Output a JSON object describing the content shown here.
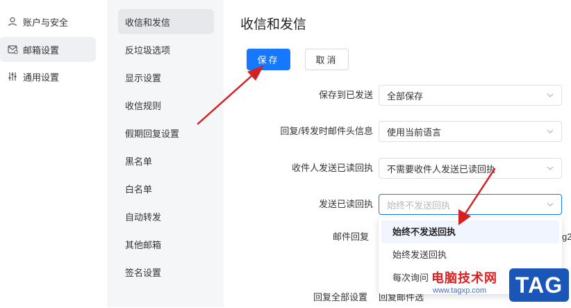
{
  "sidebar": {
    "items": [
      {
        "label": "账户与安全",
        "icon": "user-icon"
      },
      {
        "label": "邮箱设置",
        "icon": "mailbox-settings-icon",
        "active": true
      },
      {
        "label": "通用设置",
        "icon": "sliders-icon"
      }
    ]
  },
  "subnav": {
    "items": [
      {
        "label": "收信和发信",
        "active": true
      },
      {
        "label": "反垃圾选项"
      },
      {
        "label": "显示设置"
      },
      {
        "label": "收信规则"
      },
      {
        "label": "假期回复设置"
      },
      {
        "label": "黑名单"
      },
      {
        "label": "白名单"
      },
      {
        "label": "自动转发"
      },
      {
        "label": "其他邮箱"
      },
      {
        "label": "签名设置"
      }
    ]
  },
  "main": {
    "title": "收信和发信",
    "save_label": "保存",
    "cancel_label": "取消",
    "rows": [
      {
        "label": "保存到已发送",
        "value": "全部保存"
      },
      {
        "label": "回复/转发时邮件头信息",
        "value": "使用当前语言"
      },
      {
        "label": "收件人发送已读回执",
        "value": "不需要收件人发送已读回执"
      },
      {
        "label": "发送已读回执",
        "placeholder": "始终不发送回执"
      }
    ],
    "partial_rows": [
      {
        "label": "邮件回复",
        "suffix": "g2"
      },
      {
        "label": "回复全部设置",
        "value": "回复邮件选"
      }
    ]
  },
  "dropdown": {
    "options": [
      {
        "label": "始终不发送回执",
        "selected": true
      },
      {
        "label": "始终发送回执"
      },
      {
        "label": "每次询问"
      }
    ]
  },
  "watermark": {
    "site_name": "电脑技术网",
    "url": "www.tagxp.com",
    "badge": "TAG"
  },
  "colors": {
    "accent": "#1677ff",
    "annotation_arrow": "#d42020",
    "watermark_red": "#e02020",
    "watermark_blue": "#1a56b8"
  }
}
